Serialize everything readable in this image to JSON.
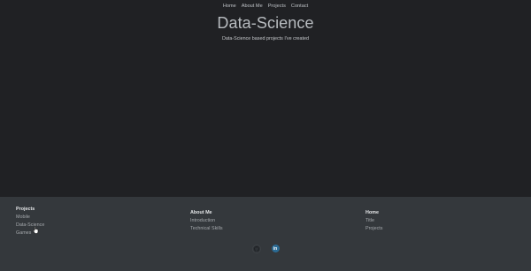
{
  "nav": {
    "items": [
      "Home",
      "About Me",
      "Projects",
      "Contact"
    ]
  },
  "hero": {
    "title": "Data-Science",
    "subtitle": "Data-Science based projects I've created"
  },
  "footer": {
    "projects": {
      "heading": "Projects",
      "links": [
        "Mobile",
        "Data-Science",
        "Games"
      ]
    },
    "about": {
      "heading": "About Me",
      "links": [
        "Introduction",
        "Technical Skills"
      ]
    },
    "home": {
      "heading": "Home",
      "links": [
        "Title",
        "Projects"
      ]
    },
    "socials": {
      "github_icon": "github-icon",
      "linkedin_icon": "linkedin-icon",
      "linkedin_label": "in"
    }
  },
  "colors": {
    "background": "#202124",
    "footer_background": "#34383c",
    "linkedin": "#2b6b94"
  }
}
